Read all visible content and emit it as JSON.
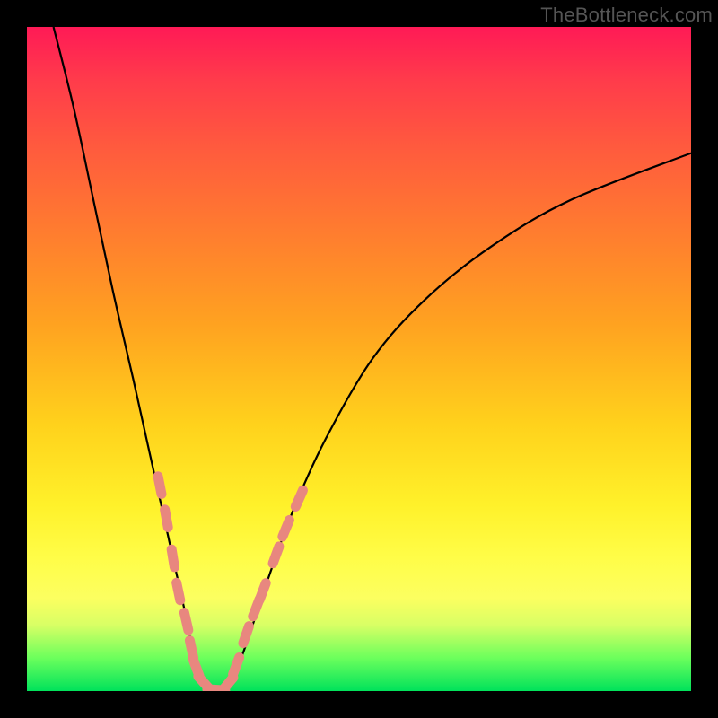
{
  "watermark": "TheBottleneck.com",
  "chart_data": {
    "type": "line",
    "title": "",
    "xlabel": "",
    "ylabel": "",
    "xlim": [
      0,
      100
    ],
    "ylim": [
      0,
      100
    ],
    "grid": false,
    "series": [
      {
        "name": "bottleneck-curve",
        "color": "#000000",
        "points": [
          {
            "x": 4,
            "y": 100
          },
          {
            "x": 7,
            "y": 88
          },
          {
            "x": 10,
            "y": 74
          },
          {
            "x": 13,
            "y": 60
          },
          {
            "x": 16,
            "y": 47
          },
          {
            "x": 18,
            "y": 38
          },
          {
            "x": 20,
            "y": 29
          },
          {
            "x": 22,
            "y": 20
          },
          {
            "x": 24,
            "y": 11
          },
          {
            "x": 25,
            "y": 6
          },
          {
            "x": 26,
            "y": 2
          },
          {
            "x": 27,
            "y": 0.4
          },
          {
            "x": 28.5,
            "y": 0
          },
          {
            "x": 30,
            "y": 0.4
          },
          {
            "x": 31,
            "y": 2
          },
          {
            "x": 33,
            "y": 7
          },
          {
            "x": 36,
            "y": 16
          },
          {
            "x": 40,
            "y": 27
          },
          {
            "x": 45,
            "y": 38
          },
          {
            "x": 52,
            "y": 50
          },
          {
            "x": 60,
            "y": 59
          },
          {
            "x": 70,
            "y": 67
          },
          {
            "x": 82,
            "y": 74
          },
          {
            "x": 100,
            "y": 81
          }
        ]
      },
      {
        "name": "data-markers",
        "color": "#e8877f",
        "points": [
          {
            "x": 20.0,
            "y": 31.0
          },
          {
            "x": 21.0,
            "y": 26.0
          },
          {
            "x": 22.0,
            "y": 20.0
          },
          {
            "x": 22.8,
            "y": 15.0
          },
          {
            "x": 24.0,
            "y": 10.5
          },
          {
            "x": 24.8,
            "y": 6.3
          },
          {
            "x": 25.5,
            "y": 3.5
          },
          {
            "x": 26.7,
            "y": 1.2
          },
          {
            "x": 28.5,
            "y": 0.2
          },
          {
            "x": 30.2,
            "y": 1.0
          },
          {
            "x": 31.5,
            "y": 3.8
          },
          {
            "x": 33.0,
            "y": 8.5
          },
          {
            "x": 34.5,
            "y": 12.5
          },
          {
            "x": 35.5,
            "y": 15.0
          },
          {
            "x": 37.5,
            "y": 20.5
          },
          {
            "x": 39.0,
            "y": 24.5
          },
          {
            "x": 41.0,
            "y": 29.0
          }
        ]
      }
    ],
    "annotations": []
  }
}
